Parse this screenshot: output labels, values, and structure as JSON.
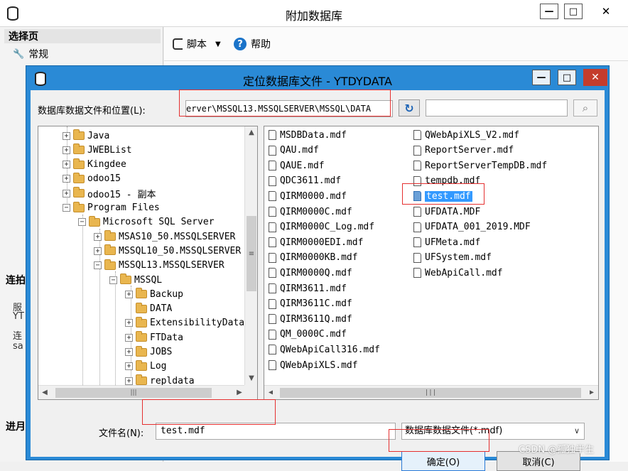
{
  "outer": {
    "title": "附加数据库",
    "pane_header": "选择页",
    "pane_item": "常规",
    "side_labels": [
      "连拍",
      "进月"
    ],
    "side_fragments": [
      "服",
      "YT",
      "连",
      "sa"
    ],
    "toolbar": {
      "script_label": "脚本",
      "help_label": "帮助"
    }
  },
  "dialog": {
    "title": "定位数据库文件 - YTDYDATA",
    "location_label": "数据库数据文件和位置(L):",
    "location_value": "erver\\MSSQL13.MSSQLSERVER\\MSSQL\\DATA",
    "search_value": "",
    "tree": [
      {
        "label": "Java",
        "level": 0,
        "expander": "+"
      },
      {
        "label": "JWEBList",
        "level": 0,
        "expander": "+"
      },
      {
        "label": "Kingdee",
        "level": 0,
        "expander": "+"
      },
      {
        "label": "odoo15",
        "level": 0,
        "expander": "+"
      },
      {
        "label": "odoo15 - 副本",
        "level": 0,
        "expander": "+"
      },
      {
        "label": "Program Files",
        "level": 0,
        "expander": "-"
      },
      {
        "label": "Microsoft SQL Server",
        "level": 1,
        "expander": "-"
      },
      {
        "label": "MSAS10_50.MSSQLSERVER",
        "level": 2,
        "expander": "+"
      },
      {
        "label": "MSSQL10_50.MSSQLSERVER",
        "level": 2,
        "expander": "+"
      },
      {
        "label": "MSSQL13.MSSQLSERVER",
        "level": 2,
        "expander": "-"
      },
      {
        "label": "MSSQL",
        "level": 3,
        "expander": "-"
      },
      {
        "label": "Backup",
        "level": 4,
        "expander": "+"
      },
      {
        "label": "DATA",
        "level": 4,
        "expander": ""
      },
      {
        "label": "ExtensibilityData",
        "level": 4,
        "expander": "+"
      },
      {
        "label": "FTData",
        "level": 4,
        "expander": "+"
      },
      {
        "label": "JOBS",
        "level": 4,
        "expander": "+"
      },
      {
        "label": "Log",
        "level": 4,
        "expander": "+"
      },
      {
        "label": "repldata",
        "level": 4,
        "expander": "+"
      }
    ],
    "files_col1": [
      "MSDBData.mdf",
      "QAU.mdf",
      "QAUE.mdf",
      "QDC3611.mdf",
      "QIRM0000.mdf",
      "QIRM0000C.mdf",
      "QIRM0000C_Log.mdf",
      "QIRM0000EDI.mdf",
      "QIRM0000KB.mdf",
      "QIRM0000Q.mdf",
      "QIRM3611.mdf",
      "QIRM3611C.mdf",
      "QIRM3611Q.mdf",
      "QM_0000C.mdf",
      "QWebApiCall316.mdf",
      "QWebApiXLS.mdf"
    ],
    "files_col2": [
      "QWebApiXLS_V2.mdf",
      "ReportServer.mdf",
      "ReportServerTempDB.mdf",
      "tempdb.mdf",
      "test.mdf",
      "UFDATA.MDF",
      "UFDATA_001_2019.MDF",
      "UFMeta.mdf",
      "UFSystem.mdf",
      "WebApiCall.mdf"
    ],
    "selected_file": "test.mdf",
    "filename_label": "文件名(N):",
    "filename_value": "test.mdf",
    "filetype_value": "数据库数据文件(*.mdf)",
    "ok_label": "确定(O)",
    "cancel_label": "取消(C)"
  },
  "watermark": "CSDN @孤独半生",
  "colors": {
    "title_blue": "#2a8ad6",
    "selection": "#3399ff",
    "highlight_red": "#e53030"
  }
}
